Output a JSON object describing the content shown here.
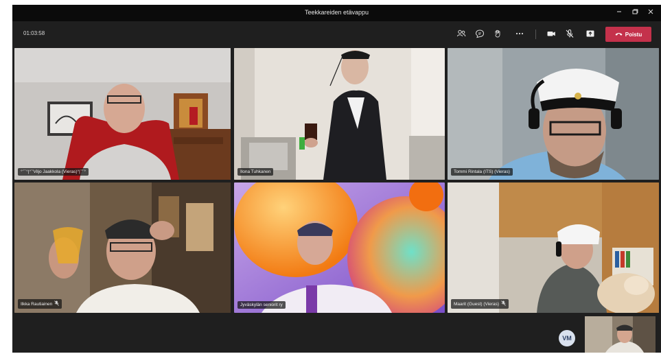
{
  "window": {
    "title": "Teekkareiden etävappu"
  },
  "toolbar": {
    "timer": "01:03:58",
    "leave_label": "Poistu",
    "accent": "#c4314b"
  },
  "participants": [
    {
      "name": "°'¨¨°|°¨'Viljo Jaakkola (Vieras)°|¨'¨°",
      "muted": false
    },
    {
      "name": "Ilona Tuhkanen",
      "muted": false
    },
    {
      "name": "Tommi Rintala (ITS) (Vieras)",
      "muted": false
    },
    {
      "name": "Ilkka Rautiainen",
      "muted": true
    },
    {
      "name": "Jyväskylän seniorit ry",
      "muted": false
    },
    {
      "name": "Maarit (Guest) (Vieras)",
      "muted": true
    }
  ],
  "self": {
    "initials": "VM"
  },
  "icons": [
    "participants-icon",
    "chat-icon",
    "reactions-icon",
    "more-icon",
    "camera-icon",
    "mic-off-icon",
    "share-icon",
    "phone-icon",
    "minimize-icon",
    "maximize-icon",
    "close-icon",
    "mic-muted-icon"
  ]
}
